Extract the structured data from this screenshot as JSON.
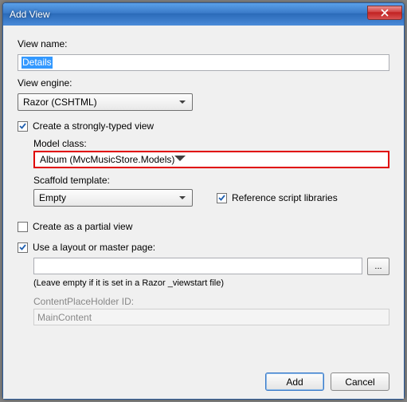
{
  "window": {
    "title": "Add View"
  },
  "viewName": {
    "label": "View name:",
    "value": "Details"
  },
  "viewEngine": {
    "label": "View engine:",
    "value": "Razor (CSHTML)"
  },
  "stronglyTyped": {
    "checked": true,
    "label": "Create a strongly-typed view",
    "modelClass": {
      "label": "Model class:",
      "value": "Album (MvcMusicStore.Models)"
    },
    "scaffold": {
      "label": "Scaffold template:",
      "value": "Empty"
    },
    "referenceScripts": {
      "checked": true,
      "label": "Reference script libraries"
    }
  },
  "partialView": {
    "checked": false,
    "label": "Create as a partial view"
  },
  "layout": {
    "checked": true,
    "label": "Use a layout or master page:",
    "path": "",
    "browse": "...",
    "hint": "(Leave empty if it is set in a Razor _viewstart file)",
    "cphLabel": "ContentPlaceHolder ID:",
    "cphValue": "MainContent"
  },
  "buttons": {
    "add": "Add",
    "cancel": "Cancel"
  }
}
